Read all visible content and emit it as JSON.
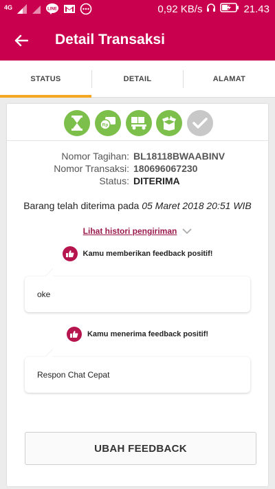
{
  "statusbar": {
    "network": "4G",
    "speed": "0,92 KB/s",
    "time": "21.43"
  },
  "appbar": {
    "title": "Detail Transaksi"
  },
  "tabs": [
    {
      "label": "STATUS",
      "active": true
    },
    {
      "label": "DETAIL",
      "active": false
    },
    {
      "label": "ALAMAT",
      "active": false
    }
  ],
  "steps": [
    {
      "icon": "hourglass-icon",
      "done": true
    },
    {
      "icon": "payment-rp-icon",
      "done": true
    },
    {
      "icon": "shipping-truck-icon",
      "done": true
    },
    {
      "icon": "package-received-icon",
      "done": true
    },
    {
      "icon": "check-icon",
      "done": false
    }
  ],
  "info": {
    "bill_label": "Nomor Tagihan:",
    "bill_value": "BL18118BWAABINV",
    "trx_label": "Nomor Transaksi:",
    "trx_value": "180696067230",
    "status_label": "Status:",
    "status_value": "DITERIMA"
  },
  "received": {
    "prefix": "Barang telah diterima pada ",
    "date": "05 Maret 2018 20:51 WIB"
  },
  "history_link": "Lihat histori pengiriman",
  "feedback_given": {
    "heading": "Kamu memberikan feedback positif!",
    "message": "oke"
  },
  "feedback_received": {
    "heading": "Kamu menerima feedback positif!",
    "message": "Respon Chat Cepat"
  },
  "change_feedback_button": "UBAH FEEDBACK",
  "colors": {
    "brand": "#c9004e",
    "tab_indicator": "#f5a623",
    "step_done": "#7cc04b",
    "step_pending": "#c8c8c8",
    "link": "#9b1a4b",
    "thumb": "#b7154e"
  }
}
